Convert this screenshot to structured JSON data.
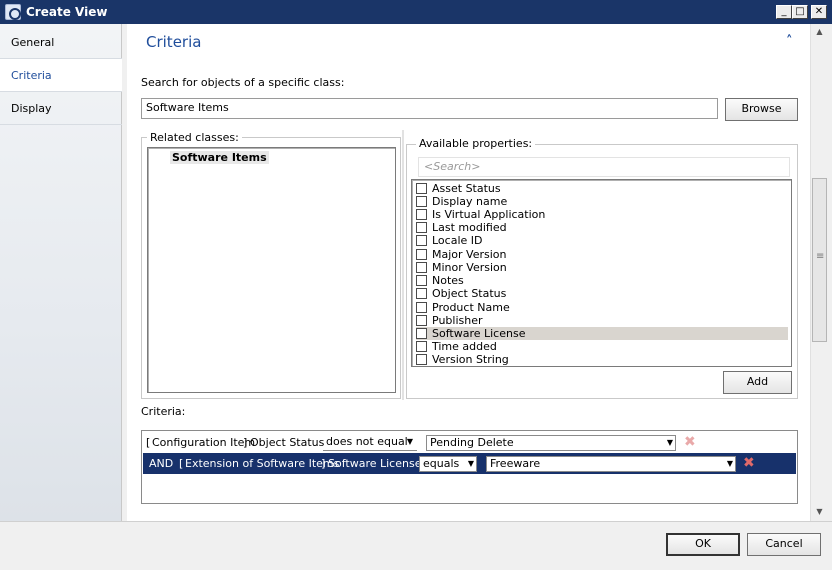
{
  "window": {
    "title": "Create View",
    "min_glyph": "_",
    "max_glyph": "□",
    "close_glyph": "✕"
  },
  "nav": {
    "items": [
      {
        "label": "General"
      },
      {
        "label": "Criteria"
      },
      {
        "label": "Display"
      }
    ]
  },
  "criteria_section": {
    "title": "Criteria",
    "collapse_glyph": "˄",
    "search_label": "Search for objects of a specific class:",
    "class_value": "Software Items",
    "browse_label": "Browse",
    "related_classes_label": "Related classes:",
    "related_classes": [
      "Software Items"
    ],
    "available_properties_label": "Available properties:",
    "search_placeholder": "<Search>",
    "properties": [
      {
        "label": "Asset Status"
      },
      {
        "label": "Display name"
      },
      {
        "label": "Is Virtual Application"
      },
      {
        "label": "Last modified"
      },
      {
        "label": "Locale ID"
      },
      {
        "label": "Major Version"
      },
      {
        "label": "Minor Version"
      },
      {
        "label": "Notes"
      },
      {
        "label": "Object Status"
      },
      {
        "label": "Product Name"
      },
      {
        "label": "Publisher"
      },
      {
        "label": "Software License"
      },
      {
        "label": "Time added"
      },
      {
        "label": "Version String"
      }
    ],
    "add_label": "Add",
    "criteria_label": "Criteria:",
    "rows": [
      {
        "prefix": "",
        "class_open": "[",
        "class": "Configuration Item",
        "class_close": "]",
        "property": "Object Status",
        "operator": "does not equal",
        "value": "Pending Delete"
      },
      {
        "prefix": "AND",
        "class_open": "[",
        "class": "Extension of Software Items",
        "class_close": "]",
        "property": "Software License",
        "operator": "equals",
        "value": "Freeware"
      }
    ],
    "delete_glyph": "✖",
    "dropdown_glyph": "▼"
  },
  "footer": {
    "ok_label": "OK",
    "cancel_label": "Cancel"
  },
  "colors": {
    "titlebar": "#1a3568",
    "accent": "#1f4d9b",
    "selected_row": "#17316b",
    "delete_icon": "#e06a6a"
  }
}
